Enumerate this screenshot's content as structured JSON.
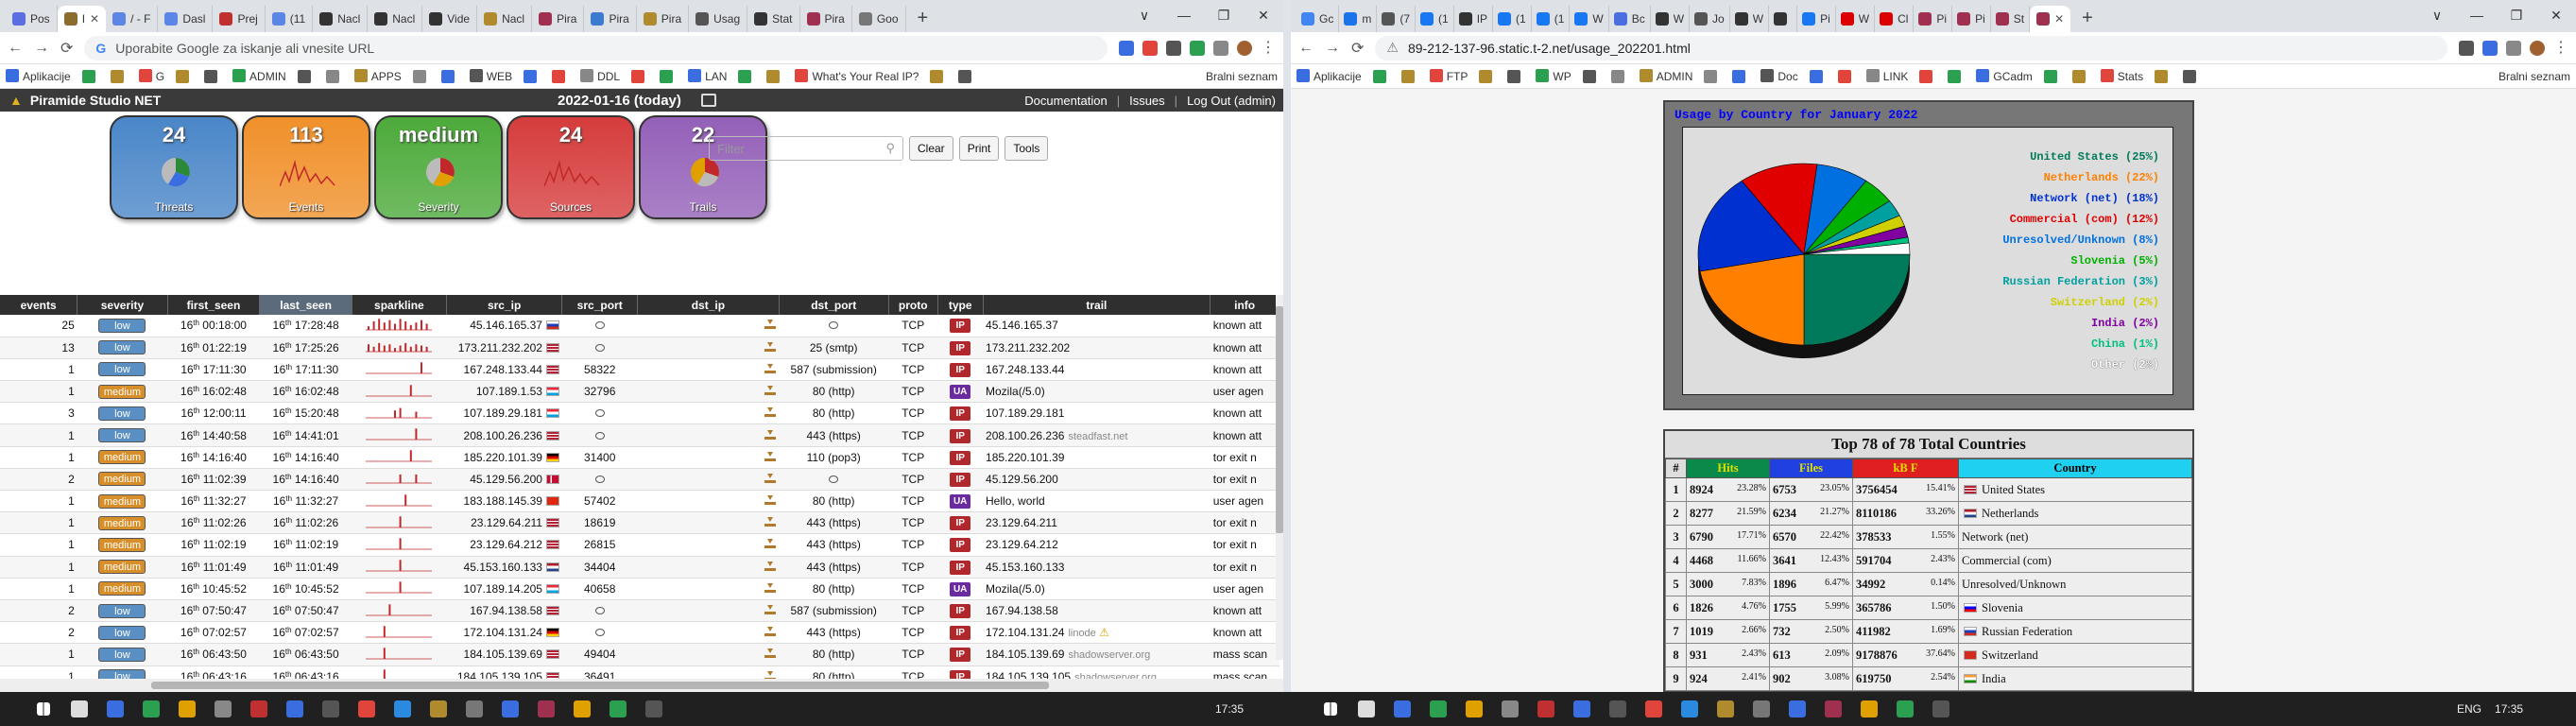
{
  "left_browser": {
    "tabs": [
      {
        "label": "Pos",
        "color": "#5b6ee1"
      },
      {
        "label": "I",
        "color": "#8b6c2e",
        "active": true
      },
      {
        "label": "/ - F",
        "color": "#5b86e5"
      },
      {
        "label": "Dasl",
        "color": "#5b86e5"
      },
      {
        "label": "Prej",
        "color": "#c03030"
      },
      {
        "label": "(11",
        "color": "#5b86e5"
      },
      {
        "label": "Nacl",
        "color": "#333333"
      },
      {
        "label": "Nacl",
        "color": "#333333"
      },
      {
        "label": "Vide",
        "color": "#333333"
      },
      {
        "label": "Nacl",
        "color": "#b08b2e"
      },
      {
        "label": "Pira",
        "color": "#a03050"
      },
      {
        "label": "Pira",
        "color": "#3a7ad0"
      },
      {
        "label": "Pira",
        "color": "#b08b2e"
      },
      {
        "label": "Usag",
        "color": "#555555"
      },
      {
        "label": "Stat",
        "color": "#333333"
      },
      {
        "label": "Pira",
        "color": "#a03050"
      },
      {
        "label": "Goo",
        "color": "#777777"
      }
    ],
    "url_placeholder": "Uporabite Google za iskanje ali vnesite URL",
    "bookmarks": [
      "Aplikacije",
      "G",
      "ADMIN",
      "APPS",
      "WEB",
      "DDL",
      "LAN",
      "What's Your Real IP?"
    ],
    "bookmarks_right": "Bralni seznam"
  },
  "app": {
    "brand": "Piramide Studio NET",
    "date": "2022-01-16 (today)",
    "nav": {
      "documentation": "Documentation",
      "issues": "Issues",
      "logout": "Log Out (admin)"
    },
    "tiles": [
      {
        "value": "24",
        "label": "Threats",
        "color": "#4a86c8"
      },
      {
        "value": "113",
        "label": "Events",
        "color": "#f0902a"
      },
      {
        "value": "medium",
        "label": "Severity",
        "color": "#4caa3a"
      },
      {
        "value": "24",
        "label": "Sources",
        "color": "#d63c3c"
      },
      {
        "value": "22",
        "label": "Trails",
        "color": "#9460b8"
      }
    ],
    "filter_placeholder": "Filter",
    "buttons": {
      "clear": "Clear",
      "print": "Print",
      "tools": "Tools"
    },
    "columns": [
      "events",
      "severity",
      "first_seen",
      "last_seen",
      "sparkline",
      "src_ip",
      "src_port",
      "dst_ip",
      "dst_port",
      "proto",
      "type",
      "trail",
      "info"
    ],
    "rows": [
      {
        "events": "25",
        "sev": "low",
        "first": "00:18:00",
        "last": "17:28:48",
        "src": "45.146.165.37",
        "flag": "ru",
        "sport": "",
        "dport": "",
        "proto": "TCP",
        "type": "IP",
        "trail": "45.146.165.37",
        "tnote": "",
        "info": "known att"
      },
      {
        "events": "13",
        "sev": "low",
        "first": "01:22:19",
        "last": "17:25:26",
        "src": "173.211.232.202",
        "flag": "us",
        "sport": "",
        "dport": "25 (smtp)",
        "proto": "TCP",
        "type": "IP",
        "trail": "173.211.232.202",
        "tnote": "",
        "info": "known att"
      },
      {
        "events": "1",
        "sev": "low",
        "first": "17:11:30",
        "last": "17:11:30",
        "src": "167.248.133.44",
        "flag": "us",
        "sport": "58322",
        "dport": "587 (submission)",
        "proto": "TCP",
        "type": "IP",
        "trail": "167.248.133.44",
        "tnote": "",
        "info": "known att"
      },
      {
        "events": "1",
        "sev": "medium",
        "first": "16:02:48",
        "last": "16:02:48",
        "src": "107.189.1.53",
        "flag": "lu",
        "sport": "32796",
        "dport": "80 (http)",
        "proto": "TCP",
        "type": "UA",
        "trail": "Mozila(/5.0)",
        "tnote": "",
        "info": "user agen"
      },
      {
        "events": "3",
        "sev": "low",
        "first": "12:00:11",
        "last": "15:20:48",
        "src": "107.189.29.181",
        "flag": "lu",
        "sport": "",
        "dport": "80 (http)",
        "proto": "TCP",
        "type": "IP",
        "trail": "107.189.29.181",
        "tnote": "",
        "info": "known att"
      },
      {
        "events": "1",
        "sev": "low",
        "first": "14:40:58",
        "last": "14:41:01",
        "src": "208.100.26.236",
        "flag": "us",
        "sport": "",
        "dport": "443 (https)",
        "proto": "TCP",
        "type": "IP",
        "trail": "208.100.26.236",
        "tnote": "steadfast.net",
        "info": "known att"
      },
      {
        "events": "1",
        "sev": "medium",
        "first": "14:16:40",
        "last": "14:16:40",
        "src": "185.220.101.39",
        "flag": "de",
        "sport": "31400",
        "dport": "110 (pop3)",
        "proto": "TCP",
        "type": "IP",
        "trail": "185.220.101.39",
        "tnote": "",
        "info": "tor exit n"
      },
      {
        "events": "2",
        "sev": "medium",
        "first": "11:02:39",
        "last": "14:16:40",
        "src": "45.129.56.200",
        "flag": "dk",
        "sport": "",
        "dport": "",
        "proto": "TCP",
        "type": "IP",
        "trail": "45.129.56.200",
        "tnote": "",
        "info": "tor exit n"
      },
      {
        "events": "1",
        "sev": "medium",
        "first": "11:32:27",
        "last": "11:32:27",
        "src": "183.188.145.39",
        "flag": "cn",
        "sport": "57402",
        "dport": "80 (http)",
        "proto": "TCP",
        "type": "UA",
        "trail": "Hello, world",
        "tnote": "",
        "info": "user agen"
      },
      {
        "events": "1",
        "sev": "medium",
        "first": "11:02:26",
        "last": "11:02:26",
        "src": "23.129.64.211",
        "flag": "us",
        "sport": "18619",
        "dport": "443 (https)",
        "proto": "TCP",
        "type": "IP",
        "trail": "23.129.64.211",
        "tnote": "",
        "info": "tor exit n"
      },
      {
        "events": "1",
        "sev": "medium",
        "first": "11:02:19",
        "last": "11:02:19",
        "src": "23.129.64.212",
        "flag": "us",
        "sport": "26815",
        "dport": "443 (https)",
        "proto": "TCP",
        "type": "IP",
        "trail": "23.129.64.212",
        "tnote": "",
        "info": "tor exit n"
      },
      {
        "events": "1",
        "sev": "medium",
        "first": "11:01:49",
        "last": "11:01:49",
        "src": "45.153.160.133",
        "flag": "nl",
        "sport": "34404",
        "dport": "443 (https)",
        "proto": "TCP",
        "type": "IP",
        "trail": "45.153.160.133",
        "tnote": "",
        "info": "tor exit n"
      },
      {
        "events": "1",
        "sev": "medium",
        "first": "10:45:52",
        "last": "10:45:52",
        "src": "107.189.14.205",
        "flag": "lu",
        "sport": "40658",
        "dport": "80 (http)",
        "proto": "TCP",
        "type": "UA",
        "trail": "Mozila(/5.0)",
        "tnote": "",
        "info": "user agen"
      },
      {
        "events": "2",
        "sev": "low",
        "first": "07:50:47",
        "last": "07:50:47",
        "src": "167.94.138.58",
        "flag": "us",
        "sport": "",
        "dport": "587 (submission)",
        "proto": "TCP",
        "type": "IP",
        "trail": "167.94.138.58",
        "tnote": "",
        "info": "known att"
      },
      {
        "events": "2",
        "sev": "low",
        "first": "07:02:57",
        "last": "07:02:57",
        "src": "172.104.131.24",
        "flag": "de",
        "sport": "",
        "dport": "443 (https)",
        "proto": "TCP",
        "type": "IP",
        "trail": "172.104.131.24",
        "tnote": "linode",
        "info": "known att"
      },
      {
        "events": "1",
        "sev": "low",
        "first": "06:43:50",
        "last": "06:43:50",
        "src": "184.105.139.69",
        "flag": "us",
        "sport": "49404",
        "dport": "80 (http)",
        "proto": "TCP",
        "type": "IP",
        "trail": "184.105.139.69",
        "tnote": "shadowserver.org",
        "info": "mass scan"
      },
      {
        "events": "1",
        "sev": "low",
        "first": "06:43:16",
        "last": "06:43:16",
        "src": "184.105.139.105",
        "flag": "us",
        "sport": "36491",
        "dport": "80 (http)",
        "proto": "TCP",
        "type": "IP",
        "trail": "184.105.139.105",
        "tnote": "shadowserver.org",
        "info": "mass scan"
      }
    ],
    "day": "16",
    "day_suffix": "th"
  },
  "right_browser": {
    "tabs": [
      "Gc",
      "m",
      "(7",
      "(1",
      "IP",
      "(1",
      "(1",
      "W",
      "Bc",
      "W",
      "Jo",
      "W",
      "",
      "Pi",
      "W",
      "Cl",
      "Pi",
      "Pi",
      "St"
    ],
    "url": "89-212-137-96.static.t-2.net/usage_202201.html",
    "bookmarks": [
      "Aplikacije",
      "FTP",
      "WP",
      "ADMIN",
      "Doc",
      "LINK",
      "GCadm",
      "Stats"
    ],
    "bookmarks_right": "Bralni seznam"
  },
  "usage": {
    "title": "Usage by Country for January 2022",
    "legend": [
      {
        "name": "United States (25%)",
        "color": "#007a5a"
      },
      {
        "name": "Netherlands (22%)",
        "color": "#ff8000"
      },
      {
        "name": "Network (net) (18%)",
        "color": "#0030d0"
      },
      {
        "name": "Commercial (com) (12%)",
        "color": "#e00000"
      },
      {
        "name": "Unresolved/Unknown (8%)",
        "color": "#0070e0"
      },
      {
        "name": "Slovenia (5%)",
        "color": "#00b000"
      },
      {
        "name": "Russian Federation (3%)",
        "color": "#00a0a0"
      },
      {
        "name": "Switzerland (2%)",
        "color": "#d0d000"
      },
      {
        "name": "India (2%)",
        "color": "#8000a0"
      },
      {
        "name": "China (1%)",
        "color": "#00c080"
      },
      {
        "name": "Other (2%)",
        "color": "#ffffff"
      }
    ]
  },
  "countries": {
    "title": "Top 78 of 78 Total Countries",
    "headers": [
      "#",
      "Hits",
      "Files",
      "kB F",
      "Country"
    ],
    "rows": [
      {
        "n": "1",
        "hits": "8924",
        "hp": "23.28%",
        "files": "6753",
        "fp": "23.05%",
        "kb": "3756454",
        "kp": "15.41%",
        "country": "United States",
        "flag": "us"
      },
      {
        "n": "2",
        "hits": "8277",
        "hp": "21.59%",
        "files": "6234",
        "fp": "21.27%",
        "kb": "8110186",
        "kp": "33.26%",
        "country": "Netherlands",
        "flag": "nl"
      },
      {
        "n": "3",
        "hits": "6790",
        "hp": "17.71%",
        "files": "6570",
        "fp": "22.42%",
        "kb": "378533",
        "kp": "1.55%",
        "country": "Network (net)",
        "flag": ""
      },
      {
        "n": "4",
        "hits": "4468",
        "hp": "11.66%",
        "files": "3641",
        "fp": "12.43%",
        "kb": "591704",
        "kp": "2.43%",
        "country": "Commercial (com)",
        "flag": ""
      },
      {
        "n": "5",
        "hits": "3000",
        "hp": "7.83%",
        "files": "1896",
        "fp": "6.47%",
        "kb": "34992",
        "kp": "0.14%",
        "country": "Unresolved/Unknown",
        "flag": ""
      },
      {
        "n": "6",
        "hits": "1826",
        "hp": "4.76%",
        "files": "1755",
        "fp": "5.99%",
        "kb": "365786",
        "kp": "1.50%",
        "country": "Slovenia",
        "flag": "si"
      },
      {
        "n": "7",
        "hits": "1019",
        "hp": "2.66%",
        "files": "732",
        "fp": "2.50%",
        "kb": "411982",
        "kp": "1.69%",
        "country": "Russian Federation",
        "flag": "ru"
      },
      {
        "n": "8",
        "hits": "931",
        "hp": "2.43%",
        "files": "613",
        "fp": "2.09%",
        "kb": "9178876",
        "kp": "37.64%",
        "country": "Switzerland",
        "flag": "ch"
      },
      {
        "n": "9",
        "hits": "924",
        "hp": "2.41%",
        "files": "902",
        "fp": "3.08%",
        "kb": "619750",
        "kp": "2.54%",
        "country": "India",
        "flag": "in"
      }
    ]
  },
  "taskbar": {
    "time_left": "17:35",
    "time_right": "17:35",
    "lang": "ENG"
  }
}
